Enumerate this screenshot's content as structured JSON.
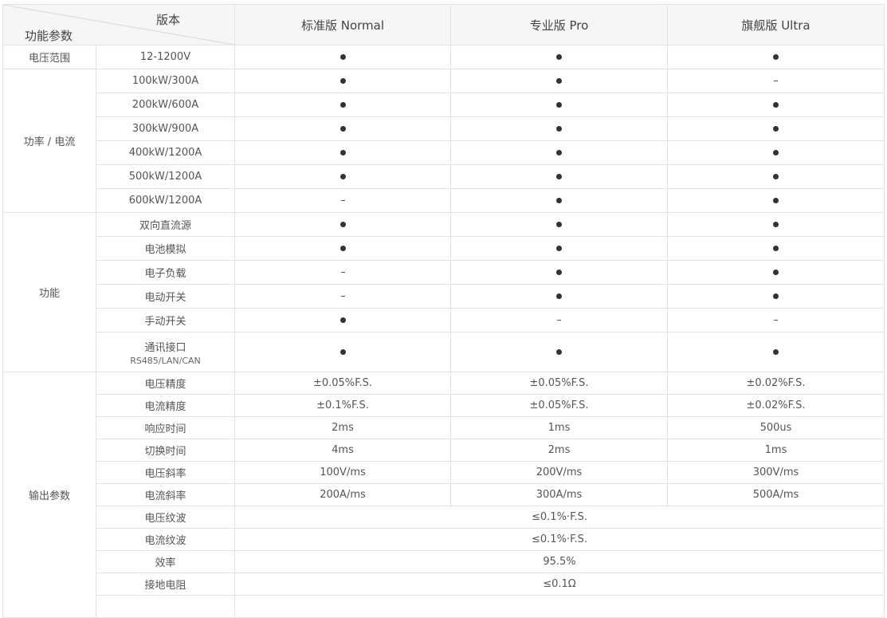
{
  "header": {
    "corner_top": "版本",
    "corner_bottom": "功能参数",
    "editions": [
      "标准版 Normal",
      "专业版 Pro",
      "旗舰版 Ultra"
    ]
  },
  "groups": {
    "voltage": "电压范围",
    "power": "功率 / 电流",
    "function": "功能",
    "output": "输出参数"
  },
  "rows": [
    {
      "param": "12-1200V",
      "vals": [
        "dot",
        "dot",
        "dot"
      ]
    },
    {
      "param": "100kW/300A",
      "vals": [
        "dot",
        "dot",
        "dash"
      ]
    },
    {
      "param": "200kW/600A",
      "vals": [
        "dot",
        "dot",
        "dot"
      ]
    },
    {
      "param": "300kW/900A",
      "vals": [
        "dot",
        "dot",
        "dot"
      ]
    },
    {
      "param": "400kW/1200A",
      "vals": [
        "dot",
        "dot",
        "dot"
      ]
    },
    {
      "param": "500kW/1200A",
      "vals": [
        "dot",
        "dot",
        "dot"
      ]
    },
    {
      "param": "600kW/1200A",
      "vals": [
        "dash",
        "dot",
        "dot"
      ]
    },
    {
      "param": "双向直流源",
      "vals": [
        "dot",
        "dot",
        "dot"
      ]
    },
    {
      "param": "电池模拟",
      "vals": [
        "dot",
        "dot",
        "dot"
      ]
    },
    {
      "param": "电子负载",
      "vals": [
        "dash",
        "dot",
        "dot"
      ]
    },
    {
      "param": "电动开关",
      "vals": [
        "dash",
        "dot",
        "dot"
      ]
    },
    {
      "param": "手动开关",
      "vals": [
        "dot",
        "dash",
        "dash"
      ]
    },
    {
      "param": "通讯接口",
      "sub": "RS485/LAN/CAN",
      "vals": [
        "dot",
        "dot",
        "dot"
      ]
    },
    {
      "param": "电压精度",
      "vals": [
        "±0.05%F.S.",
        "±0.05%F.S.",
        "±0.02%F.S."
      ]
    },
    {
      "param": "电流精度",
      "vals": [
        "±0.1%F.S.",
        "±0.05%F.S.",
        "±0.02%F.S."
      ]
    },
    {
      "param": "响应时间",
      "vals": [
        "2ms",
        "1ms",
        "500us"
      ]
    },
    {
      "param": "切换时间",
      "vals": [
        "4ms",
        "2ms",
        "1ms"
      ]
    },
    {
      "param": "电压斜率",
      "vals": [
        "100V/ms",
        "200V/ms",
        "300V/ms"
      ]
    },
    {
      "param": "电流斜率",
      "vals": [
        "200A/ms",
        "300A/ms",
        "500A/ms"
      ]
    },
    {
      "param": "电压纹波",
      "merged": "≤0.1%·F.S."
    },
    {
      "param": "电流纹波",
      "merged": "≤0.1%·F.S."
    },
    {
      "param": "效率",
      "merged": "95.5%"
    },
    {
      "param": "接地电阻",
      "merged": "≤0.1Ω"
    }
  ]
}
